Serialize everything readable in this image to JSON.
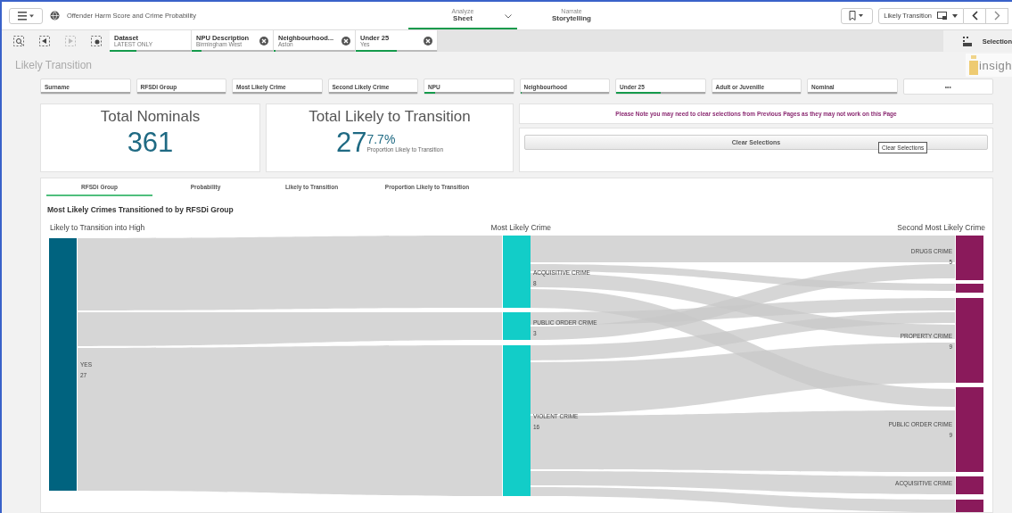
{
  "app": {
    "title": "Offender Harm Score and Crime Probability"
  },
  "modes": [
    {
      "caption": "Analyze",
      "label": "Sheet",
      "selected": true
    },
    {
      "caption": "Narrate",
      "label": "Storytelling",
      "selected": false
    }
  ],
  "sheet_nav": {
    "label": "Likely Transition"
  },
  "selections": [
    {
      "field": "Dataset",
      "value": "LATEST ONLY",
      "removable": false,
      "level": 0.33
    },
    {
      "field": "NPU Description",
      "value": "Birmingham West",
      "removable": true,
      "level": 0.12
    },
    {
      "field": "Neighbourhood...",
      "value": "Aston",
      "removable": true,
      "level": 0.02
    },
    {
      "field": "Under 25",
      "value": "Yes",
      "removable": true,
      "level": 0.5
    }
  ],
  "selections_button": "Selection",
  "sheet": {
    "title": "Likely Transition",
    "logo_text": "insigh"
  },
  "filters": [
    {
      "label": "Surname"
    },
    {
      "label": "RFSDI Group"
    },
    {
      "label": "Most Likely Crime"
    },
    {
      "label": "Second Likely Crime"
    },
    {
      "label": "NPU",
      "level": 0.12
    },
    {
      "label": "Neighbourhood",
      "level": 0.02
    },
    {
      "label": "Under 25",
      "level": 0.5
    },
    {
      "label": "Adult or Juvenille"
    },
    {
      "label": "Nominal"
    }
  ],
  "more_filters": "•••",
  "kpis": [
    {
      "title": "Total Nominals",
      "value": "361"
    },
    {
      "title": "Total Likely to Transition",
      "value": "27",
      "secondary": "7.7%",
      "caption": "Proportion Likely to Transition"
    }
  ],
  "note": "Please Note you may need to clear selections from Previous Pages as they may not work on this Page",
  "clear_button": "Clear Selections",
  "tooltip": "Clear Selections",
  "chart_tabs": [
    {
      "label": "RFSDi Group",
      "selected": true
    },
    {
      "label": "Probability",
      "selected": false
    },
    {
      "label": "Likely to Transition",
      "selected": false
    },
    {
      "label": "Proportion Likely to Transition",
      "selected": false
    }
  ],
  "chart": {
    "title": "Most Likely Crimes Transitioned to by RFSDi Group",
    "columns": [
      {
        "heading": "Likely to Transition into High",
        "color": "#00637f",
        "nodes": [
          {
            "label": "YES",
            "count": "27"
          }
        ]
      },
      {
        "heading": "Most Likely Crime",
        "color": "#12cdc8",
        "nodes": [
          {
            "label": "ACQUISITIVE CRIME",
            "count": "8"
          },
          {
            "label": "PUBLIC ORDER CRIME",
            "count": "3"
          },
          {
            "label": "VIOLENT CRIME",
            "count": "16"
          }
        ]
      },
      {
        "heading": "Second Most Likely Crime",
        "color": "#8a1a5b",
        "nodes": [
          {
            "label": "DRUGS CRIME",
            "count": "5"
          },
          {
            "label": "PROPERTY CRIME",
            "count": "9"
          },
          {
            "label": "PUBLIC ORDER CRIME",
            "count": "9"
          },
          {
            "label": "ACQUISITIVE CRIME"
          }
        ]
      }
    ]
  }
}
